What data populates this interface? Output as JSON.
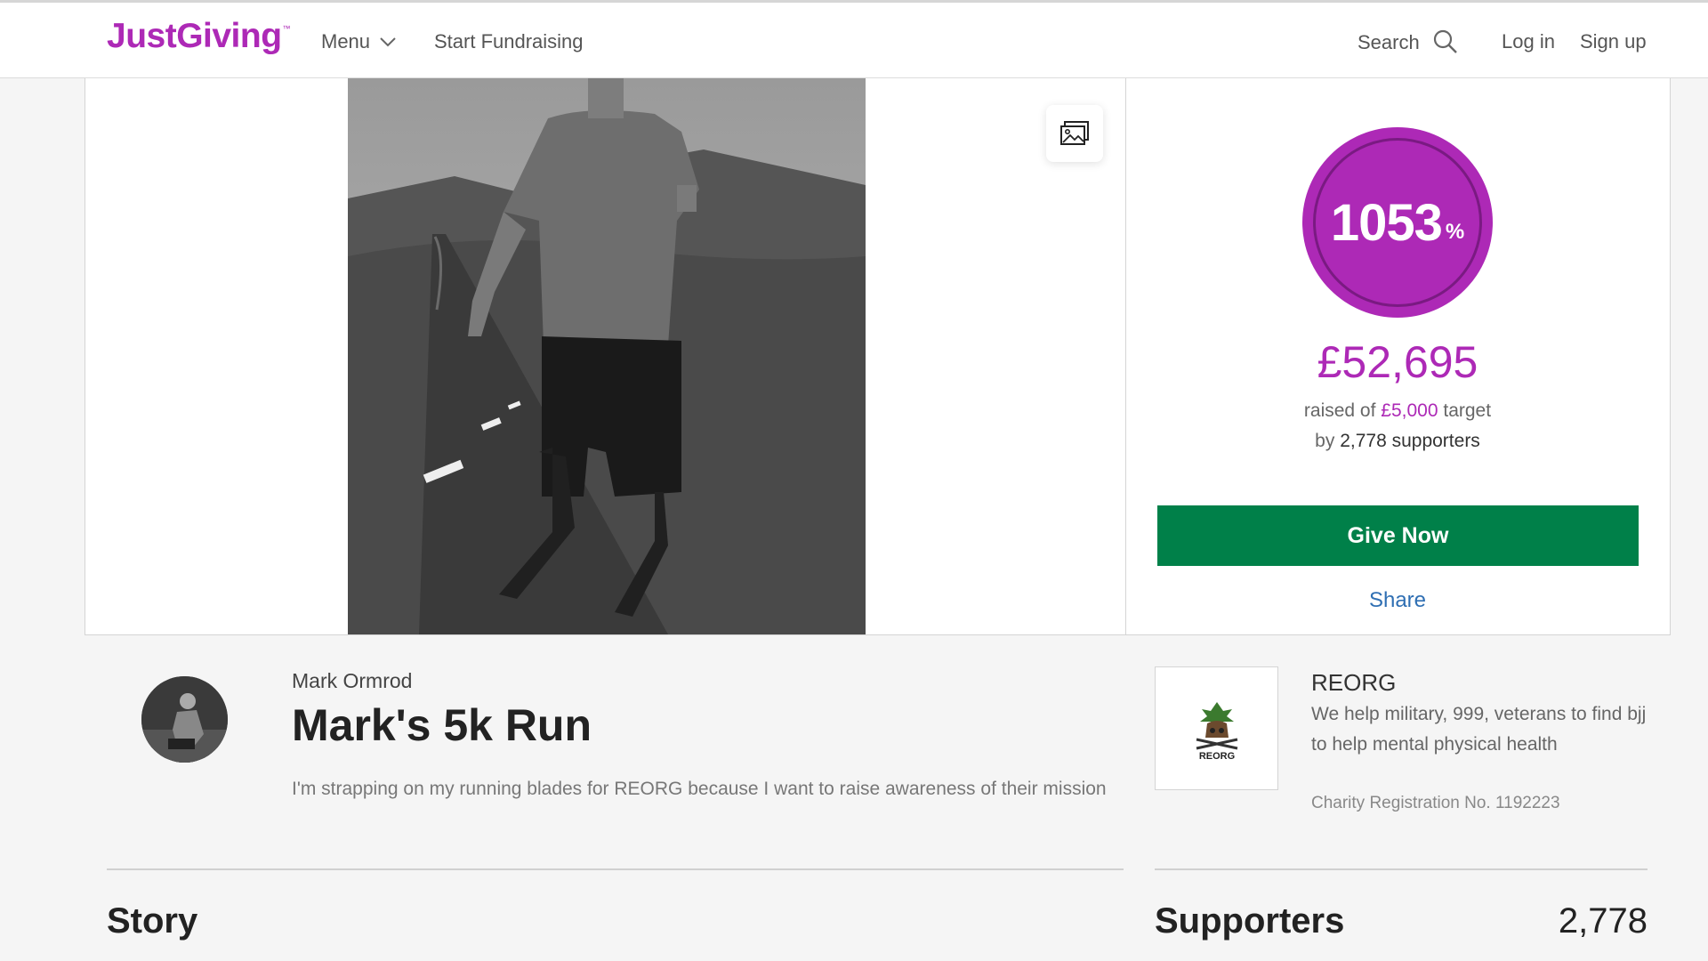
{
  "header": {
    "logo_text": "JustGiving",
    "logo_tm": "™",
    "menu_label": "Menu",
    "start_label": "Start Fundraising",
    "search_label": "Search",
    "login_label": "Log in",
    "signup_label": "Sign up",
    "icons": [
      "chevron-down-icon",
      "search-icon"
    ]
  },
  "hero": {
    "gallery_icon": "image-gallery-icon"
  },
  "progress": {
    "percent": "1053",
    "percent_sign": "%",
    "raised": "£52,695",
    "raised_of": "raised of",
    "target": "£5,000",
    "target_suffix": "target",
    "by": "by",
    "supporters_text": "2,778 supporters",
    "give_label": "Give Now",
    "share_label": "Share"
  },
  "page": {
    "owner": "Mark Ormrod",
    "title": "Mark's 5k Run",
    "description": "I'm strapping on my running blades for REORG because I want to raise awareness of their mission"
  },
  "charity": {
    "name": "REORG",
    "description": "We help military, 999, veterans to find bjj to help mental physical health",
    "registration": "Charity Registration No. 1192223",
    "logo_text": "REORG"
  },
  "sections": {
    "story": "Story",
    "supporters": "Supporters",
    "supporters_count": "2,778"
  },
  "colors": {
    "brand": "#ad29b6",
    "give_button": "#008049",
    "link": "#2f6fb3"
  }
}
